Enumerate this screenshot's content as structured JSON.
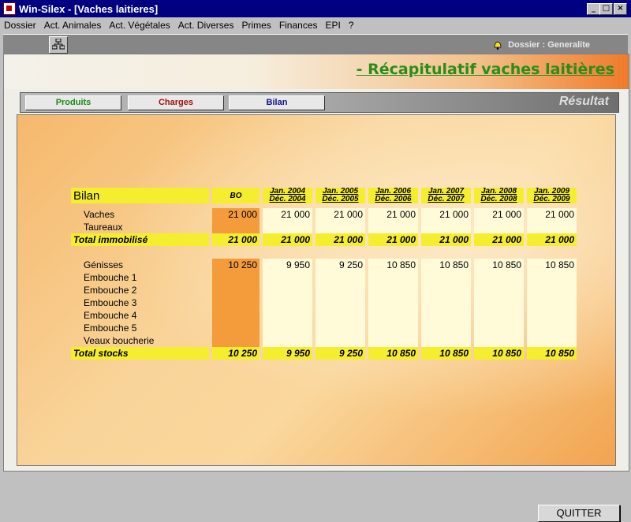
{
  "window": {
    "title": "Win-Silex - [Vaches laitieres]",
    "controls": {
      "minimize": "_",
      "maximize": "□",
      "close": "×"
    }
  },
  "menu": [
    "Dossier",
    "Act. Animales",
    "Act. Végétales",
    "Act. Diverses",
    "Primes",
    "Finances",
    "EPI",
    "?"
  ],
  "toolbar": {
    "dossier_label": "Dossier : Generalite",
    "icons": [
      "structure-icon",
      "bell-icon"
    ]
  },
  "page": {
    "title": "- Récapitulatif vaches laitières"
  },
  "tabs": {
    "produits": "Produits",
    "charges": "Charges",
    "bilan": "Bilan",
    "resultat": "Résultat",
    "colors": {
      "produits": "#1a8a1a",
      "charges": "#a01010",
      "bilan": "#10108a"
    }
  },
  "table": {
    "title": "Bilan",
    "bo_header": "BO",
    "years": [
      {
        "start": "Jan. 2004",
        "end": "Déc. 2004"
      },
      {
        "start": "Jan. 2005",
        "end": "Déc. 2005"
      },
      {
        "start": "Jan. 2006",
        "end": "Déc. 2006"
      },
      {
        "start": "Jan. 2007",
        "end": "Déc. 2007"
      },
      {
        "start": "Jan. 2008",
        "end": "Déc. 2008"
      },
      {
        "start": "Jan. 2009",
        "end": "Déc. 2009"
      }
    ],
    "immobilise_rows": [
      {
        "label": "Vaches",
        "bo": "21 000",
        "values": [
          "21 000",
          "21 000",
          "21 000",
          "21 000",
          "21 000",
          "21 000"
        ]
      },
      {
        "label": "Taureaux",
        "bo": "",
        "values": [
          "",
          "",
          "",
          "",
          "",
          ""
        ]
      }
    ],
    "total_immobilise": {
      "label": "Total immobilisé",
      "bo": "21 000",
      "values": [
        "21 000",
        "21 000",
        "21 000",
        "21 000",
        "21 000",
        "21 000"
      ]
    },
    "stock_rows": [
      {
        "label": "Génisses",
        "bo": "10 250",
        "values": [
          "9 950",
          "9 250",
          "10 850",
          "10 850",
          "10 850",
          "10 850"
        ]
      },
      {
        "label": "Embouche 1",
        "bo": "",
        "values": [
          "",
          "",
          "",
          "",
          "",
          ""
        ]
      },
      {
        "label": "Embouche 2",
        "bo": "",
        "values": [
          "",
          "",
          "",
          "",
          "",
          ""
        ]
      },
      {
        "label": "Embouche 3",
        "bo": "",
        "values": [
          "",
          "",
          "",
          "",
          "",
          ""
        ]
      },
      {
        "label": "Embouche 4",
        "bo": "",
        "values": [
          "",
          "",
          "",
          "",
          "",
          ""
        ]
      },
      {
        "label": "Embouche 5",
        "bo": "",
        "values": [
          "",
          "",
          "",
          "",
          "",
          ""
        ]
      },
      {
        "label": "Veaux boucherie",
        "bo": "",
        "values": [
          "",
          "",
          "",
          "",
          "",
          ""
        ]
      }
    ],
    "total_stocks": {
      "label": "Total stocks",
      "bo": "10 250",
      "values": [
        "9 950",
        "9 250",
        "10 850",
        "10 850",
        "10 850",
        "10 850"
      ]
    }
  },
  "buttons": {
    "quit": "QUITTER"
  }
}
